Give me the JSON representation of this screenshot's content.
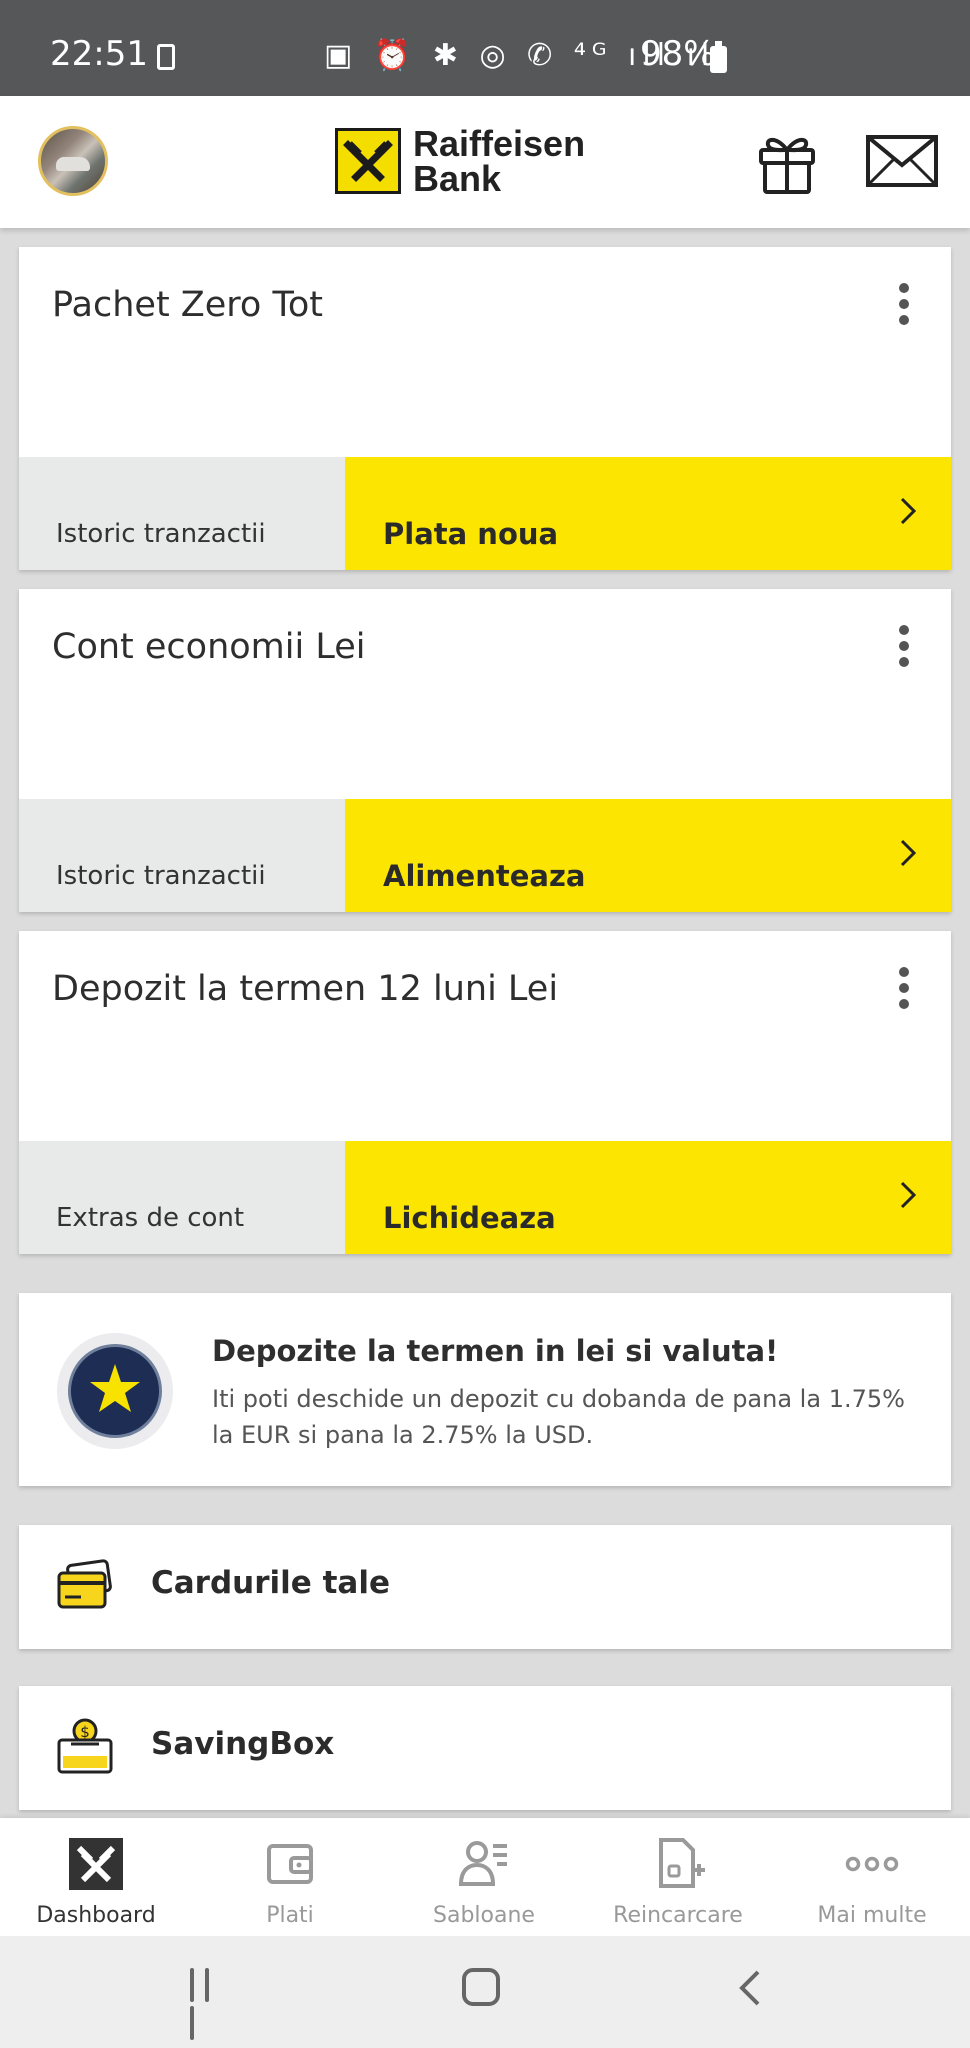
{
  "status_bar": {
    "time": "22:51",
    "battery": "98%",
    "icons_text": "▣ ⏰ ✱ ◎ ✆ ⁴ᴳ ıll ıll"
  },
  "header": {
    "brand_line1": "Raiffeisen",
    "brand_line2": "Bank",
    "gift_icon": "gift-icon",
    "mail_icon": "mail-icon",
    "brand_color": "#FCE500"
  },
  "accounts": [
    {
      "title": "Pachet Zero Tot",
      "secondary": "Istoric tranzactii",
      "primary": "Plata noua"
    },
    {
      "title": "Cont economii Lei",
      "secondary": "Istoric tranzactii",
      "primary": "Alimenteaza"
    },
    {
      "title": "Depozit la termen 12 luni Lei",
      "secondary": "Extras de cont",
      "primary": "Lichideaza"
    }
  ],
  "promo": {
    "title": "Depozite la termen in lei si valuta!",
    "text": "Iti poti deschide un depozit cu dobanda de pana la 1.75% la EUR si pana la 2.75% la USD.",
    "icon": "star-badge-icon"
  },
  "menu": [
    {
      "label": "Cardurile tale",
      "icon": "card-icon"
    },
    {
      "label": "SavingBox",
      "icon": "savingbox-icon"
    }
  ],
  "bottom_nav": [
    {
      "label": "Dashboard",
      "icon": "dashboard-icon",
      "active": true
    },
    {
      "label": "Plati",
      "icon": "wallet-icon",
      "active": false
    },
    {
      "label": "Sabloane",
      "icon": "user-list-icon",
      "active": false
    },
    {
      "label": "Reincarcare",
      "icon": "document-add-icon",
      "active": false
    },
    {
      "label": "Mai multe",
      "icon": "more-icon",
      "active": false
    }
  ],
  "colors": {
    "accent_yellow": "#FCE500",
    "secondary_gray": "#E8E9E9",
    "status_bar": "#555759"
  }
}
